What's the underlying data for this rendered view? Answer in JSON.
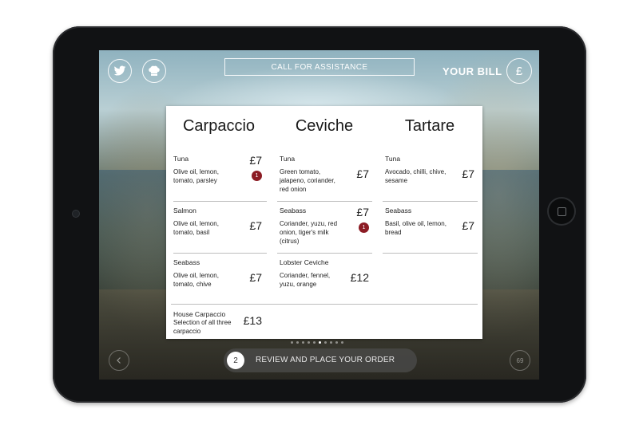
{
  "header": {
    "assistance_label": "CALL FOR ASSISTANCE",
    "bill_label": "YOUR BILL",
    "bill_icon_glyph": "£"
  },
  "menu": {
    "columns": [
      {
        "title": "Carpaccio",
        "items": [
          {
            "name": "Tuna",
            "description": "Olive oil, lemon, tomato, parsley",
            "price": "£7",
            "badge": "1"
          },
          {
            "name": "Salmon",
            "description": "Olive oil, lemon, tomato, basil",
            "price": "£7"
          },
          {
            "name": "Seabass",
            "description": "Olive oil, lemon, tomato, chive",
            "price": "£7"
          },
          {
            "name": "House Carpaccio",
            "description": "Selection of all three carpaccio",
            "price": "£13"
          }
        ]
      },
      {
        "title": "Ceviche",
        "items": [
          {
            "name": "Tuna",
            "description": "Green tomato, jalapeno, coriander, red onion",
            "price": "£7"
          },
          {
            "name": "Seabass",
            "description": "Coriander, yuzu, red onion, tiger's milk (citrus)",
            "price": "£7",
            "badge": "1"
          },
          {
            "name": "Lobster Ceviche",
            "description": "Coriander, fennel, yuzu, orange",
            "price": "£12"
          }
        ]
      },
      {
        "title": "Tartare",
        "items": [
          {
            "name": "Tuna",
            "description": "Avocado, chilli, chive, sesame",
            "price": "£7"
          },
          {
            "name": "Seabass",
            "description": "Basil, olive oil, lemon, bread",
            "price": "£7"
          }
        ]
      }
    ]
  },
  "footer": {
    "order_count": "2",
    "order_label": "REVIEW AND PLACE YOUR ORDER",
    "right_badge": "69"
  },
  "colors": {
    "badge": "#8c1c24",
    "panel": "#ffffff",
    "order_bar": "#464644"
  },
  "icons": {
    "twitter": "twitter-icon",
    "chef": "chef-hat-icon",
    "bill": "pound-icon"
  }
}
